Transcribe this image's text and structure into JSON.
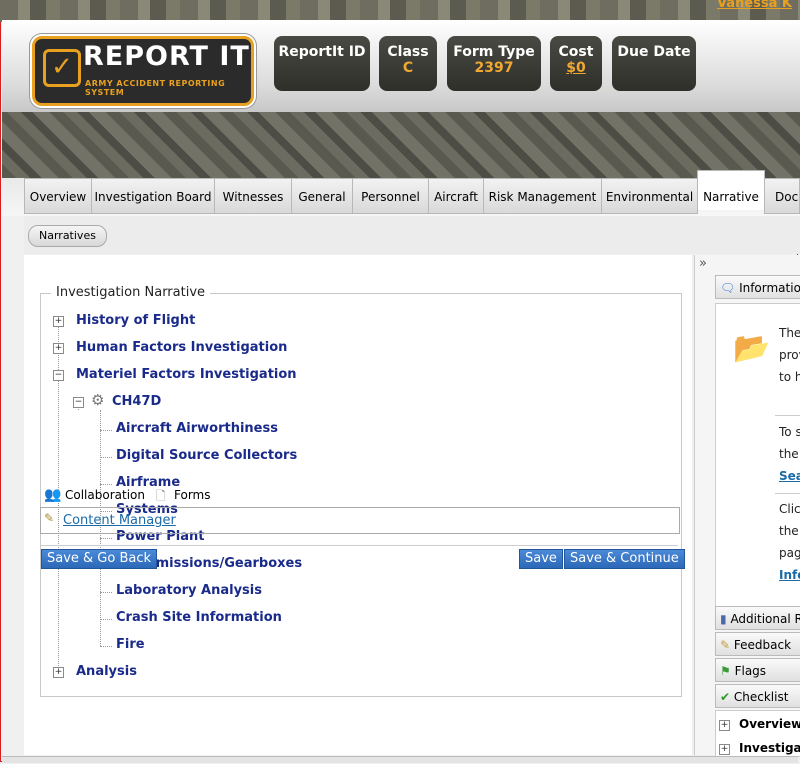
{
  "user": {
    "name": "Vanessa K"
  },
  "logo": {
    "title": "REPORT IT",
    "subtitle": "ARMY ACCIDENT REPORTING SYSTEM"
  },
  "header_fields": [
    {
      "label": "ReportIt ID",
      "value": ""
    },
    {
      "label": "Class",
      "value": "C"
    },
    {
      "label": "Form Type",
      "value": "2397"
    },
    {
      "label": "Cost",
      "value": "$0"
    },
    {
      "label": "Due Date",
      "value": ""
    }
  ],
  "tabs": [
    "Overview",
    "Investigation Board",
    "Witnesses",
    "General",
    "Personnel",
    "Aircraft",
    "Risk Management",
    "Environmental",
    "Narrative",
    "Doc"
  ],
  "active_tab": "Narrative",
  "subtabs": [
    "Narratives"
  ],
  "narrative": {
    "legend": "Investigation Narrative",
    "tree": [
      {
        "label": "History of Flight",
        "expanded": false
      },
      {
        "label": "Human Factors Investigation",
        "expanded": false
      },
      {
        "label": "Materiel Factors Investigation",
        "expanded": true,
        "children": [
          {
            "label": "CH47D",
            "expanded": true,
            "children": [
              "Aircraft Airworthiness",
              "Digital Source Collectors",
              "Airframe",
              "Systems",
              "Power Plant",
              "Transmissions/Gearboxes",
              "Laboratory Analysis",
              "Crash Site Information",
              "Fire"
            ]
          }
        ]
      },
      {
        "label": "Analysis",
        "expanded": false
      }
    ]
  },
  "overlay": {
    "collaboration": "Collaboration",
    "forms": "Forms",
    "content_manager": "Content Manager"
  },
  "buttons": {
    "save_go_back": "Save & Go Back",
    "save": "Save",
    "save_continue": "Save & Continue"
  },
  "right_panel": {
    "collapse": "»",
    "information": "Information",
    "info_lines": [
      "The",
      "prov",
      "to h"
    ],
    "lines2": [
      "To s",
      "the"
    ],
    "link1": "Sea",
    "lines3": [
      "Clic",
      "the",
      "pag"
    ],
    "link2": "Info",
    "items": [
      "Additional R",
      "Feedback",
      "Flags",
      "Checklist"
    ],
    "checklist_tree": [
      "Overview",
      "Investigati"
    ]
  },
  "colors": {
    "accent": "#e8a020",
    "link": "#1a6aa8",
    "tree_text": "#1a2a8a",
    "button": "#2c68b8"
  }
}
